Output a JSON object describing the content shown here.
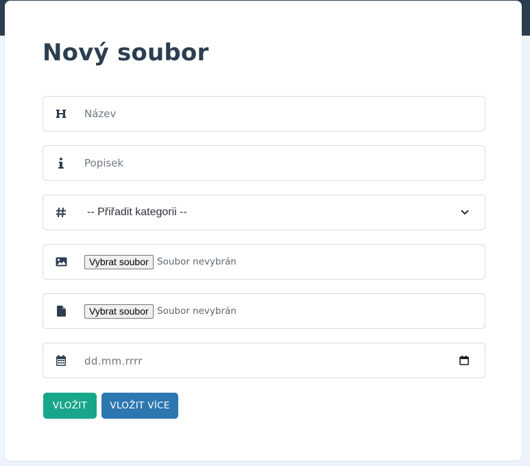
{
  "form": {
    "title": "Nový soubor",
    "name_placeholder": "Název",
    "description_placeholder": "Popisek",
    "category_selected": "-- Přiřadit kategorii --",
    "image_file": {
      "button": "Vybrat soubor",
      "status": "Soubor nevybrán"
    },
    "document_file": {
      "button": "Vybrat soubor",
      "status": "Soubor nevybrán"
    },
    "date_placeholder": "dd.mm.rrrr",
    "submit_label": "VLOŽIT",
    "submit_more_label": "VLOŽIT VÍCE"
  },
  "icons": {
    "name": "heading-icon",
    "description": "info-icon",
    "category": "hashtag-icon",
    "image": "image-icon",
    "document": "file-icon",
    "date": "calendar-icon"
  },
  "colors": {
    "topbar": "#2c3e50",
    "primary_button": "#18a68a",
    "secondary_button": "#2c77b0",
    "title_text": "#2c3e50"
  }
}
